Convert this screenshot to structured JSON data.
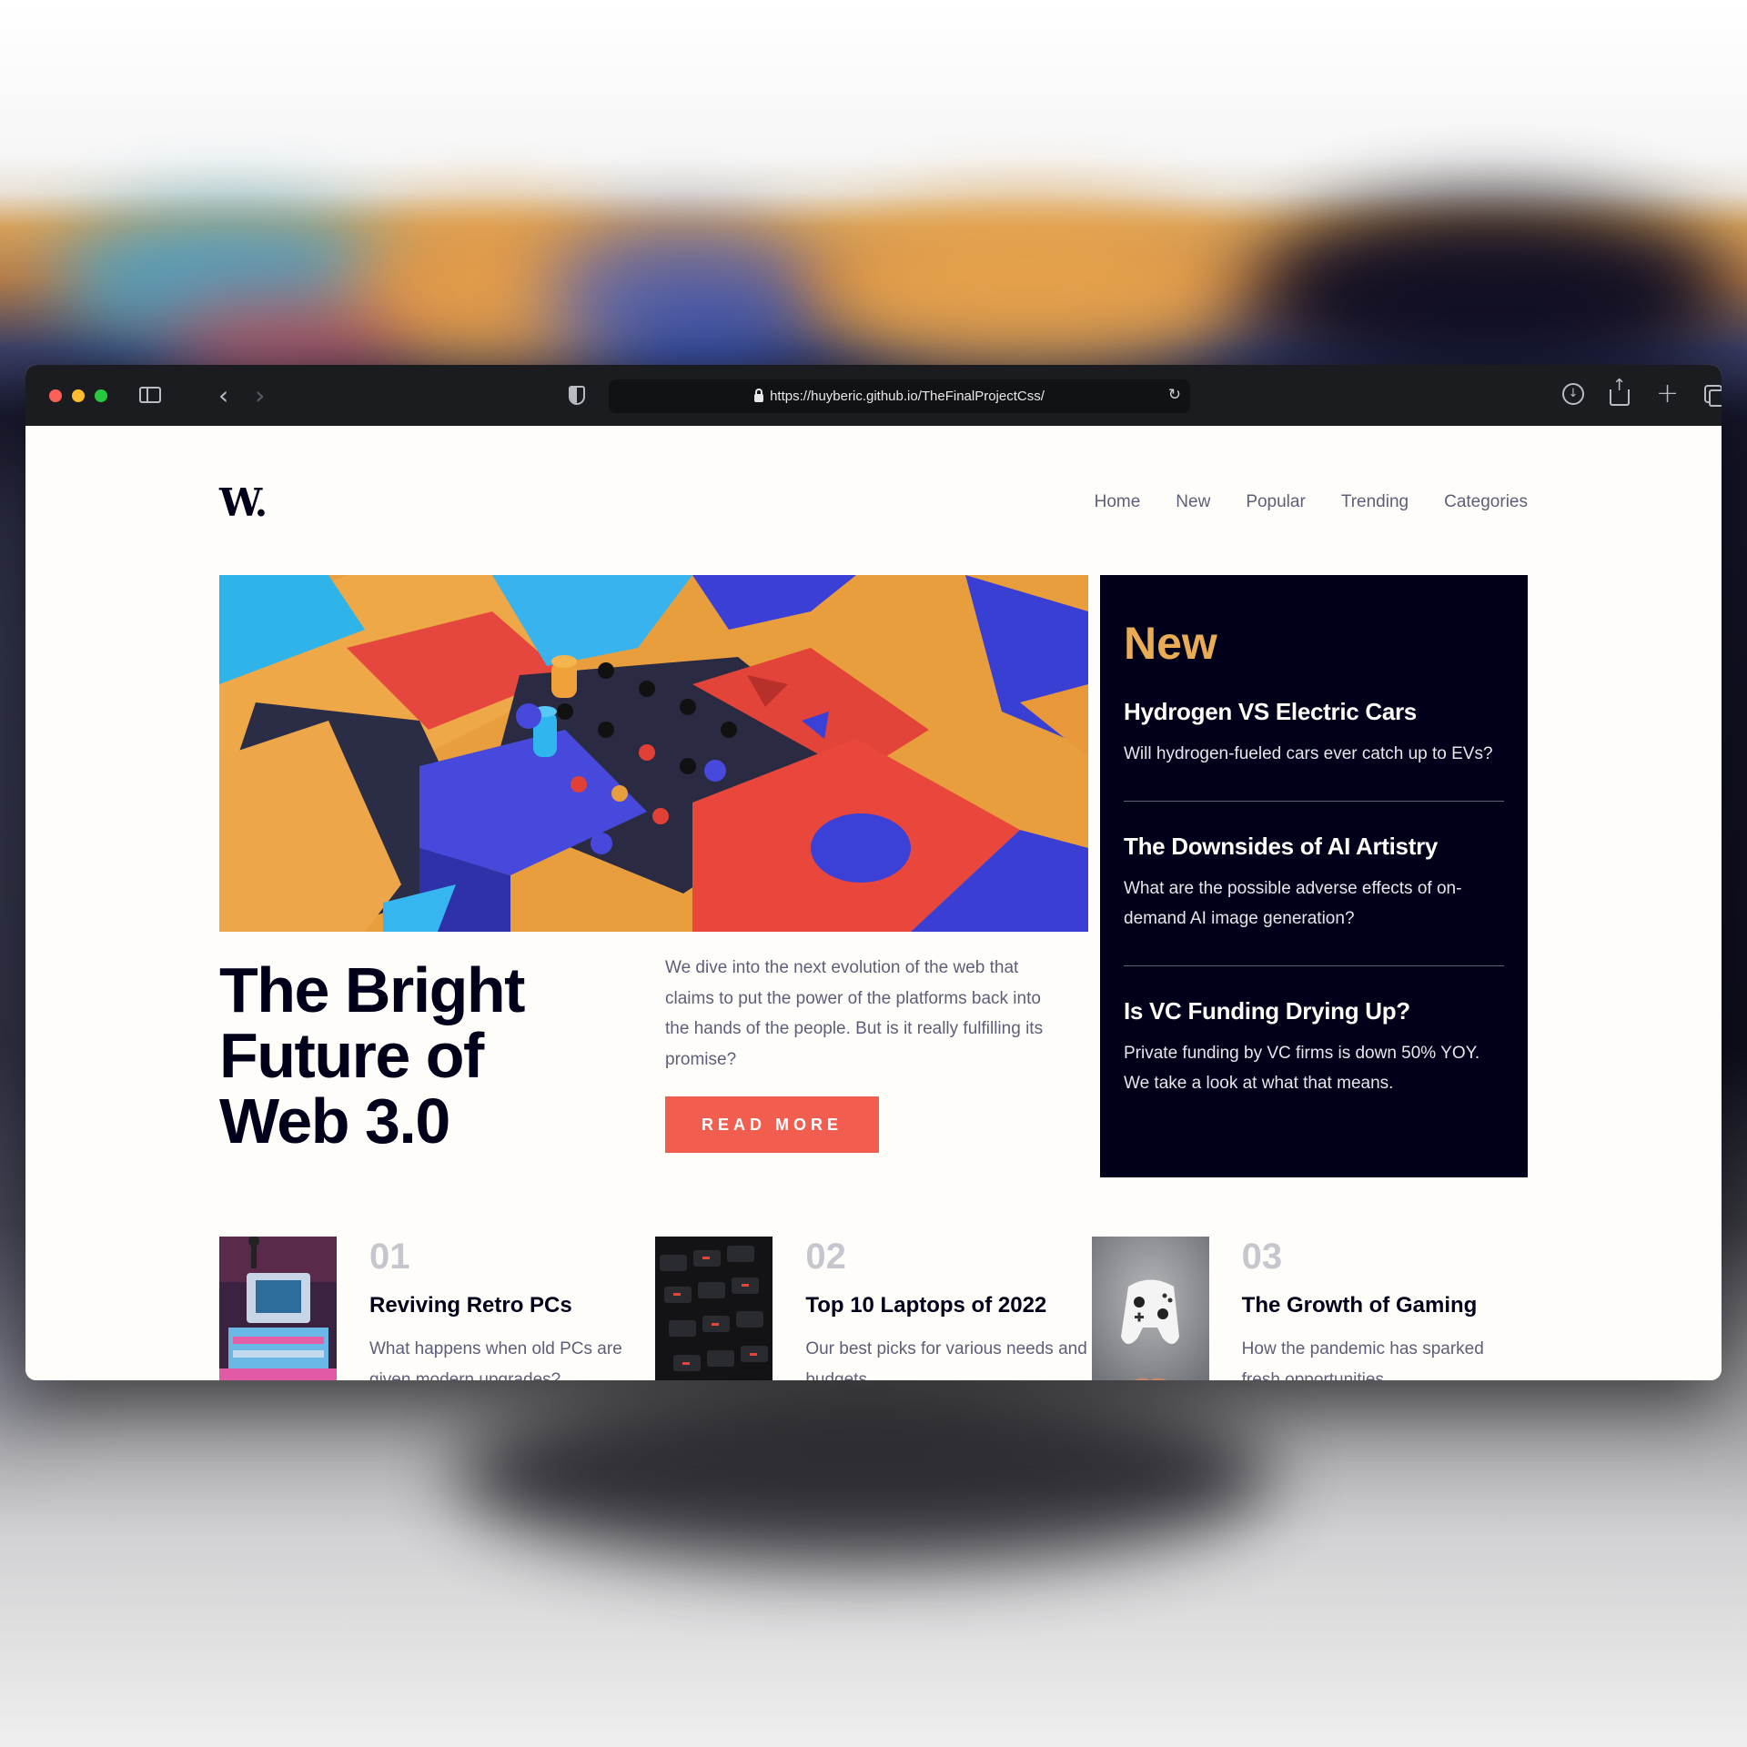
{
  "browser": {
    "url": "https://huyberic.github.io/TheFinalProjectCss/"
  },
  "site": {
    "logo": "W.",
    "nav": [
      "Home",
      "New",
      "Popular",
      "Trending",
      "Categories"
    ]
  },
  "hero": {
    "title": "The Bright Future of Web 3.0",
    "description": "We dive into the next evolution of the web that claims to put the power of the platforms back into the hands of the people. But is it really fulfilling its promise?",
    "button_label": "READ MORE"
  },
  "new_section": {
    "heading": "New",
    "items": [
      {
        "title": "Hydrogen VS Electric Cars",
        "text": "Will hydrogen-fueled cars ever catch up to EVs?"
      },
      {
        "title": "The Downsides of AI Artistry",
        "text": "What are the possible adverse effects of on-demand AI image generation?"
      },
      {
        "title": "Is VC Funding Drying Up?",
        "text": "Private funding by VC firms is down 50% YOY. We take a look at what that means."
      }
    ]
  },
  "articles": [
    {
      "number": "01",
      "title": "Reviving Retro PCs",
      "text": "What happens when old PCs are given modern upgrades?"
    },
    {
      "number": "02",
      "title": "Top 10 Laptops of 2022",
      "text": "Our best picks for various needs and budgets."
    },
    {
      "number": "03",
      "title": "The Growth of Gaming",
      "text": "How the pandemic has sparked fresh opportunities."
    }
  ],
  "colors": {
    "accent_orange": "#e9ab53",
    "button_red": "#f15e50",
    "dark_navy": "#00001a",
    "body_text": "#5d5f79"
  },
  "icons": [
    "close-icon",
    "minimize-icon",
    "zoom-icon",
    "sidebar-icon",
    "back-icon",
    "forward-icon",
    "shield-icon",
    "lock-icon",
    "reload-icon",
    "download-icon",
    "share-icon",
    "new-tab-icon",
    "tabs-overview-icon"
  ]
}
